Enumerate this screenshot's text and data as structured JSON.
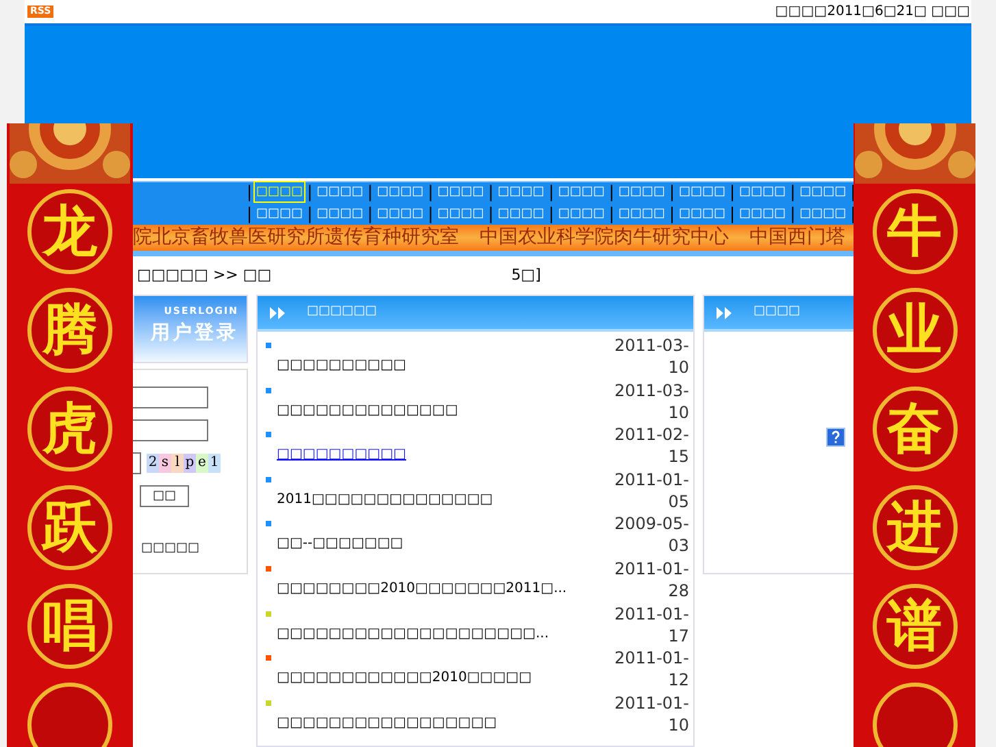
{
  "top_bar": {
    "rss_badge": "RSS",
    "date_text": "□□□□2011□6□21□ □□□"
  },
  "nav": {
    "separator": "|",
    "rows": [
      [
        {
          "label": "□□□□",
          "selected": true
        },
        {
          "label": "□□□□",
          "selected": false
        },
        {
          "label": "□□□□",
          "selected": false
        },
        {
          "label": "□□□□",
          "selected": false
        },
        {
          "label": "□□□□",
          "selected": false
        },
        {
          "label": "□□□□",
          "selected": false
        },
        {
          "label": "□□□□",
          "selected": false
        },
        {
          "label": "□□□□",
          "selected": false
        },
        {
          "label": "□□□□",
          "selected": false
        },
        {
          "label": "□□□□",
          "selected": false
        }
      ],
      [
        {
          "label": "□□□□",
          "selected": false
        },
        {
          "label": "□□□□",
          "selected": false
        },
        {
          "label": "□□□□",
          "selected": false
        },
        {
          "label": "□□□□",
          "selected": false
        },
        {
          "label": "□□□□",
          "selected": false
        },
        {
          "label": "□□□□",
          "selected": false
        },
        {
          "label": "□□□□",
          "selected": false
        },
        {
          "label": "□□□□",
          "selected": false
        },
        {
          "label": "□□□□",
          "selected": false
        },
        {
          "label": "□□□□",
          "selected": false
        }
      ]
    ]
  },
  "marquee": [
    "院北京畜牧兽医研究所遗传育种研究室",
    "中国农业科学院肉牛研究中心",
    "中国西门塔"
  ],
  "breadcrumb": {
    "path": "□□□□□ >> □□",
    "extra": "5□]"
  },
  "login": {
    "header_caption": "USERLOGIN",
    "header_title": "用户登录",
    "captcha": [
      "2",
      "s",
      "l",
      "p",
      "e",
      "1"
    ],
    "submit": "□□",
    "link": "□□□□□"
  },
  "news": {
    "title": "□□□□□□",
    "items": [
      {
        "title": "□□□□□□□□□□",
        "date": "2011-03-10",
        "color": "#1e90ff",
        "highlighted": false
      },
      {
        "title": "□□□□□□□□□□□□□□",
        "date": "2011-03-10",
        "color": "#1e90ff",
        "highlighted": false
      },
      {
        "title": "□□□□□□□□□□",
        "date": "2011-02-15",
        "color": "#1e90ff",
        "highlighted": true
      },
      {
        "title": "2011□□□□□□□□□□□□□□",
        "date": "2011-01-05",
        "color": "#1e90ff",
        "highlighted": false
      },
      {
        "title": "□□--□□□□□□□",
        "date": "2009-05-03",
        "color": "#1e90ff",
        "highlighted": false
      },
      {
        "title": "□□□□□□□□2010□□□□□□□2011□...",
        "date": "2011-01-28",
        "color": "#ff5500",
        "highlighted": false
      },
      {
        "title": "□□□□□□□□□□□□□□□□□□□□...",
        "date": "2011-01-17",
        "color": "#c8d832",
        "highlighted": false
      },
      {
        "title": "□□□□□□□□□□□□2010□□□□□",
        "date": "2011-01-12",
        "color": "#ff5500",
        "highlighted": false
      },
      {
        "title": "□□□□□□□□□□□□□□□□□",
        "date": "2011-01-10",
        "color": "#c8d832",
        "highlighted": false
      }
    ]
  },
  "side_panel": {
    "title": "□□□□"
  },
  "left_couplet": [
    "龙",
    "腾",
    "虎",
    "跃",
    "唱"
  ],
  "right_couplet": [
    "牛",
    "业",
    "奋",
    "进",
    "谱"
  ]
}
